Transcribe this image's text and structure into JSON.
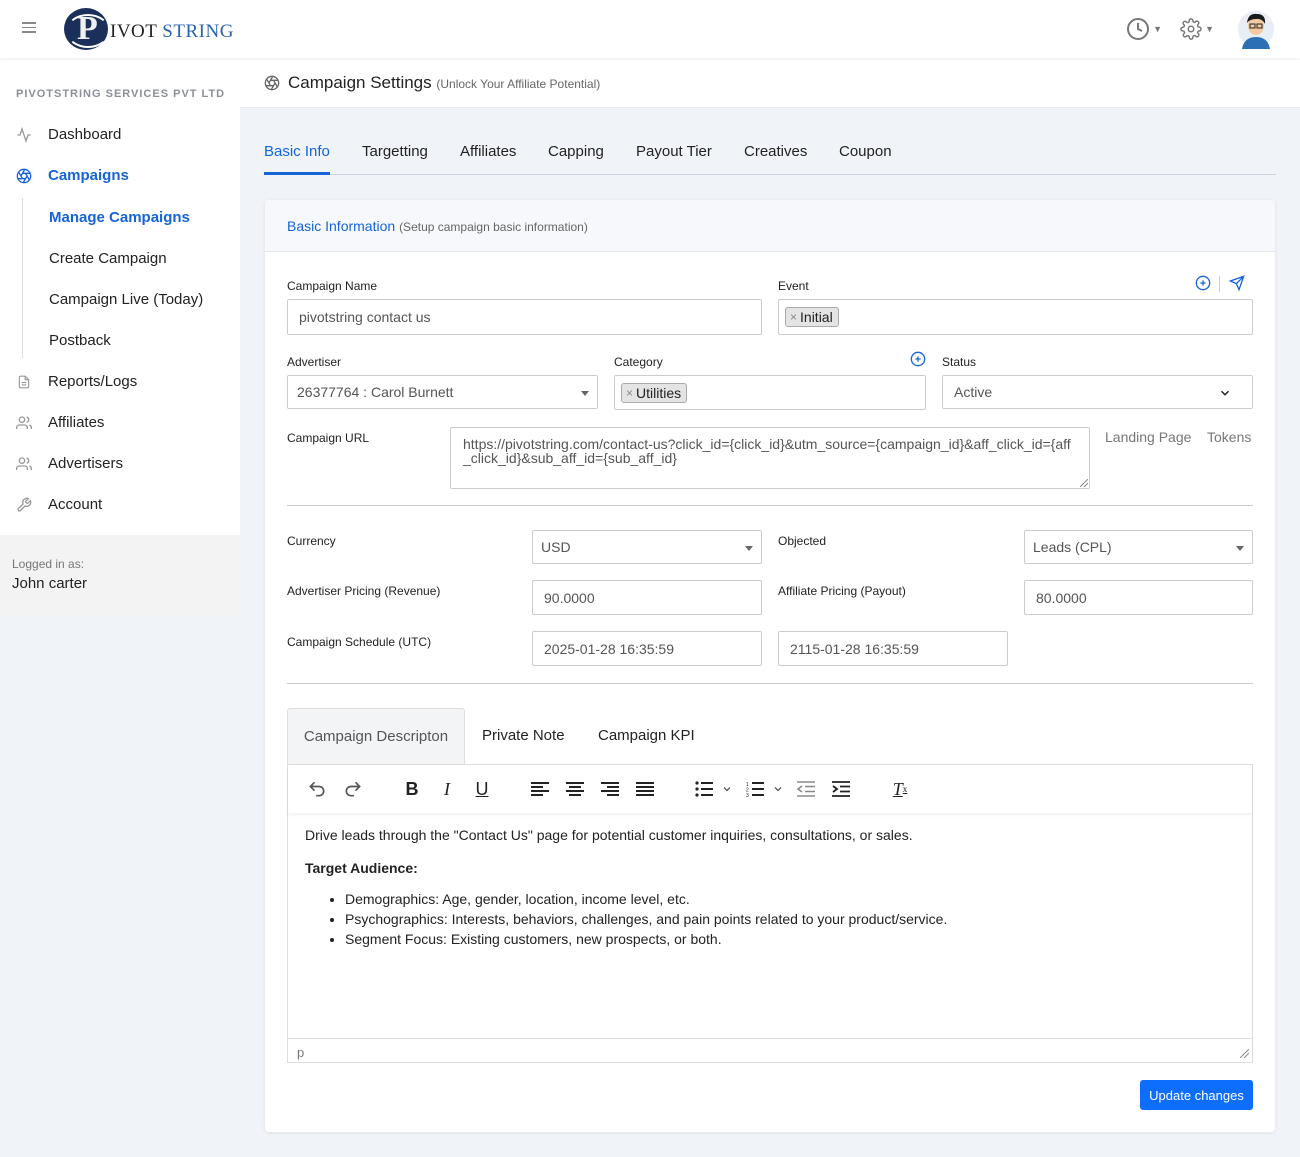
{
  "brand": {
    "logo_letter": "P",
    "logo_text_a": "IVOT",
    "logo_text_b": "STRING"
  },
  "sidebar": {
    "company": "PIVOTSTRING SERVICES PVT LTD",
    "items": [
      {
        "label": "Dashboard",
        "icon": "activity-icon"
      },
      {
        "label": "Campaigns",
        "icon": "aperture-icon",
        "active": true
      },
      {
        "label": "Reports/Logs",
        "icon": "file-icon"
      },
      {
        "label": "Affiliates",
        "icon": "users-icon"
      },
      {
        "label": "Advertisers",
        "icon": "users-icon"
      },
      {
        "label": "Account",
        "icon": "wrench-icon"
      }
    ],
    "subitems": [
      {
        "label": "Manage Campaigns",
        "active": true
      },
      {
        "label": "Create Campaign"
      },
      {
        "label": "Campaign Live (Today)"
      },
      {
        "label": "Postback"
      }
    ],
    "logged_label": "Logged in as:",
    "logged_user": "John carter"
  },
  "page": {
    "title": "Campaign Settings",
    "subtitle": "(Unlock Your Affiliate Potential)"
  },
  "tabs": [
    "Basic Info",
    "Targetting",
    "Affiliates",
    "Capping",
    "Payout Tier",
    "Creatives",
    "Coupon"
  ],
  "card": {
    "title": "Basic Information",
    "subtitle": "(Setup campaign basic information)"
  },
  "form": {
    "campaign_name_label": "Campaign Name",
    "campaign_name_value": "pivotstring contact us",
    "event_label": "Event",
    "event_chip": "Initial",
    "advertiser_label": "Advertiser",
    "advertiser_value": "26377764 : Carol Burnett",
    "category_label": "Category",
    "category_chip": "Utilities",
    "status_label": "Status",
    "status_value": "Active",
    "url_label": "Campaign URL",
    "url_value": "https://pivotstring.com/contact-us?click_id={click_id}&utm_source={campaign_id}&aff_click_id={aff_click_id}&sub_aff_id={sub_aff_id}",
    "landing_page_link": "Landing Page",
    "tokens_link": "Tokens",
    "currency_label": "Currency",
    "currency_value": "USD",
    "objected_label": "Objected",
    "objected_value": "Leads (CPL)",
    "adv_pricing_label": "Advertiser Pricing (Revenue)",
    "adv_pricing_value": "90.0000",
    "aff_pricing_label": "Affiliate Pricing (Payout)",
    "aff_pricing_value": "80.0000",
    "schedule_label": "Campaign Schedule (UTC)",
    "schedule_start": "2025-01-28 16:35:59",
    "schedule_end": "2115-01-28 16:35:59"
  },
  "subtabs": [
    "Campaign Descripton",
    "Private Note",
    "Campaign KPI"
  ],
  "editor": {
    "intro": "Drive leads through the \"Contact Us\" page for potential customer inquiries, consultations, or sales.",
    "heading": "Target Audience:",
    "bullets": [
      "Demographics: Age, gender, location, income level, etc.",
      "Psychographics: Interests, behaviors, challenges, and pain points related to your product/service.",
      "Segment Focus: Existing customers, new prospects, or both."
    ],
    "status_path": "p"
  },
  "update_button": "Update changes",
  "colors": {
    "accent": "#1565d8",
    "button": "#0d6efd"
  }
}
